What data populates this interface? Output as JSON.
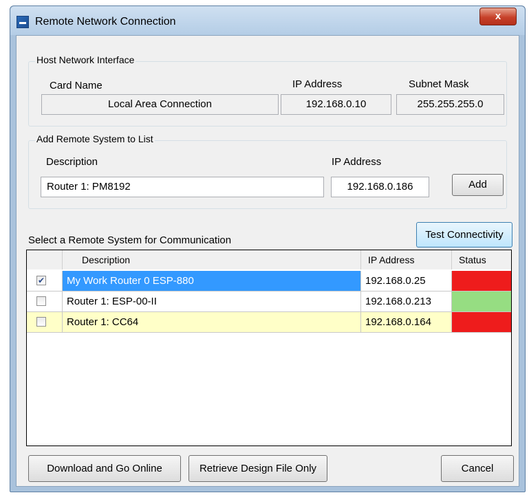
{
  "window": {
    "title": "Remote Network Connection",
    "close_glyph": "x"
  },
  "host": {
    "group_label": "Host Network Interface",
    "card_name_label": "Card Name",
    "ip_label": "IP Address",
    "subnet_label": "Subnet Mask",
    "card_name_value": "Local Area Connection",
    "ip_value": "192.168.0.10",
    "subnet_value": "255.255.255.0"
  },
  "add_remote": {
    "group_label": "Add Remote System to List",
    "description_label": "Description",
    "ip_label": "IP Address",
    "description_value": "Router 1: PM8192",
    "ip_value": "192.168.0.186",
    "add_label": "Add"
  },
  "remote": {
    "select_label": "Select a Remote System for Communication",
    "test_label": "Test Connectivity",
    "columns": {
      "description": "Description",
      "ip": "IP Address",
      "status": "Status"
    },
    "rows": [
      {
        "checked": true,
        "description": "My Work Router 0 ESP-880",
        "ip": "192.168.0.25",
        "status_color": "#ee1c1c",
        "row_state": "selected"
      },
      {
        "checked": false,
        "description": "Router 1: ESP-00-II",
        "ip": "192.168.0.213",
        "status_color": "#96dd82",
        "row_state": "normal"
      },
      {
        "checked": false,
        "description": "Router 1: CC64",
        "ip": "192.168.0.164",
        "status_color": "#ee1c1c",
        "row_state": "highlighted"
      }
    ]
  },
  "footer": {
    "download_label": "Download and Go Online",
    "retrieve_label": "Retrieve Design File Only",
    "cancel_label": "Cancel"
  },
  "colors": {
    "selected_row": "#3399ff",
    "highlighted_row": "#ffffc8",
    "status_red": "#ee1c1c",
    "status_green": "#96dd82"
  },
  "icons": {
    "app": "network-app-icon",
    "close": "close-icon",
    "checkbox": "checkbox-icon"
  }
}
